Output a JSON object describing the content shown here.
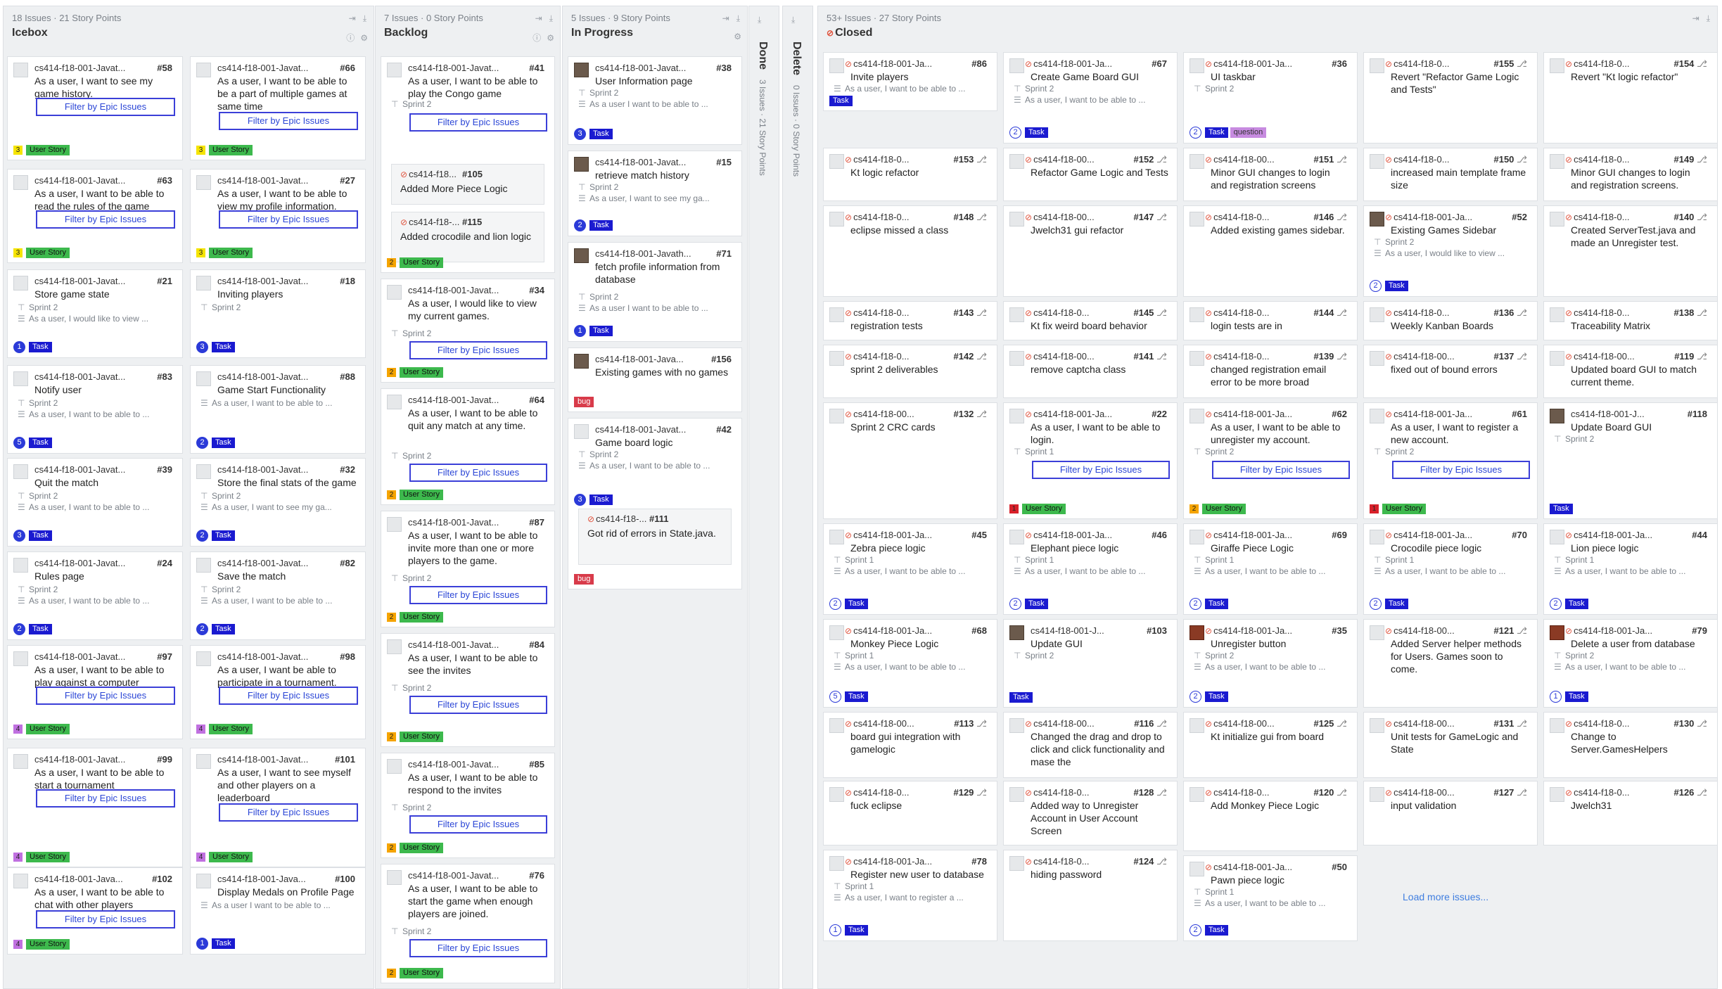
{
  "columns": {
    "icebox": {
      "count": "18 Issues · 21 Story Points",
      "title": "Icebox"
    },
    "backlog": {
      "count": "7 Issues · 0 Story Points",
      "title": "Backlog"
    },
    "inprogress": {
      "count": "5 Issues · 9 Story Points",
      "title": "In Progress"
    },
    "done": {
      "title": "Done",
      "count": "3 Issues · 21 Story Points"
    },
    "delete": {
      "title": "Delete",
      "count": "0 Issues · 0 Story Points"
    },
    "closed": {
      "count": "53+ Issues · 27 Story Points",
      "title": "Closed"
    }
  },
  "filter_label": "Filter by Epic Issues",
  "labels": {
    "task": "Task",
    "user_story": "User Story",
    "bug": "bug",
    "question": "question"
  },
  "load_more": "Load more issues...",
  "colors": {
    "task": "#1a1ad0",
    "user_story": "#3db94d",
    "bug": "#d83b4a",
    "question": "#c78be0",
    "link": "#2b46d6"
  },
  "icons": {
    "pin": "pin-icon",
    "sprint": "sprint-milestone-icon",
    "body": "description-icon",
    "closed": "closed-issue-icon",
    "pr": "pull-request-icon"
  },
  "icebox": [
    {
      "ref": "cs414-f18-001-Javat...",
      "num": "#58",
      "title": "As a user, I want to see my game history.",
      "pts": "3"
    },
    {
      "ref": "cs414-f18-001-Javat...",
      "num": "#66",
      "title": "As a user, I want to be able to be a part of multiple games at same time",
      "pts": "3"
    },
    {
      "ref": "cs414-f18-001-Javat...",
      "num": "#63",
      "title": "As a user, I want to be able to read the rules of the game",
      "pts": "3"
    },
    {
      "ref": "cs414-f18-001-Javat...",
      "num": "#27",
      "title": "As a user, I want to be able to view my profile information.",
      "pts": "3"
    },
    {
      "ref": "cs414-f18-001-Javat...",
      "num": "#21",
      "title": "Store game state",
      "sprint": "Sprint 2",
      "body": "As a user, I would like to view ...",
      "pts": "1"
    },
    {
      "ref": "cs414-f18-001-Javat...",
      "num": "#18",
      "title": "Inviting players",
      "sprint": "Sprint 2",
      "pts": "3"
    },
    {
      "ref": "cs414-f18-001-Javat...",
      "num": "#83",
      "title": "Notify user",
      "sprint": "Sprint 2",
      "body": "As a user, I want to be able to ...",
      "pts": "5"
    },
    {
      "ref": "cs414-f18-001-Javat...",
      "num": "#88",
      "title": "Game Start Functionality",
      "body": "As a user, I want to be able to ...",
      "pts": "2"
    },
    {
      "ref": "cs414-f18-001-Javat...",
      "num": "#39",
      "title": "Quit the match",
      "sprint": "Sprint 2",
      "body": "As a user, I want to be able to ...",
      "pts": "3"
    },
    {
      "ref": "cs414-f18-001-Javat...",
      "num": "#32",
      "title": "Store the final stats of the game",
      "sprint": "Sprint 2",
      "body": "As a user, I want to see my ga...",
      "pts": "2"
    },
    {
      "ref": "cs414-f18-001-Javat...",
      "num": "#24",
      "title": "Rules page",
      "sprint": "Sprint 2",
      "body": "As a user, I want to be able to ...",
      "pts": "2"
    },
    {
      "ref": "cs414-f18-001-Javat...",
      "num": "#82",
      "title": "Save the match",
      "sprint": "Sprint 2",
      "body": "As a user, I want to be able to ...",
      "pts": "2"
    },
    {
      "ref": "cs414-f18-001-Javat...",
      "num": "#97",
      "title": "As a user, I want to be able to play against a computer",
      "pts": "4"
    },
    {
      "ref": "cs414-f18-001-Javat...",
      "num": "#98",
      "title": "As a user, I want be able to participate in a tournament.",
      "pts": "4"
    },
    {
      "ref": "cs414-f18-001-Javat...",
      "num": "#99",
      "title": "As a user, I want to be able to start a tournament",
      "pts": "4"
    },
    {
      "ref": "cs414-f18-001-Javat...",
      "num": "#101",
      "title": "As a user, I want to see myself and other players on a leaderboard",
      "pts": "4"
    },
    {
      "ref": "cs414-f18-001-Java...",
      "num": "#102",
      "title": "As a user, I want to be able to chat with other players",
      "pts": "4"
    },
    {
      "ref": "cs414-f18-001-Java...",
      "num": "#100",
      "title": "Display Medals on Profile Page",
      "body": "As a user I want to be able to ...",
      "pts": "1"
    }
  ],
  "backlog": [
    {
      "ref": "cs414-f18-001-Javat...",
      "num": "#41",
      "title": "As a user, I want to be able to play the Congo game",
      "sprint": "Sprint 2",
      "pts": "2",
      "subs": [
        {
          "ref": "cs414-f18...",
          "num": "#105",
          "title": "Added More Piece Logic"
        },
        {
          "ref": "cs414-f18-...",
          "num": "#115",
          "title": "Added crocodile and lion logic"
        }
      ]
    },
    {
      "ref": "cs414-f18-001-Javat...",
      "num": "#34",
      "title": "As a user, I would like to view my current games.",
      "sprint": "Sprint 2",
      "pts": "2"
    },
    {
      "ref": "cs414-f18-001-Javat...",
      "num": "#64",
      "title": "As a user, I want to be able to quit any match at any time.",
      "sprint": "Sprint 2",
      "pts": "2"
    },
    {
      "ref": "cs414-f18-001-Javat...",
      "num": "#87",
      "title": "As a user, I want to be able to invite more than one or more players to the game.",
      "sprint": "Sprint 2",
      "pts": "2"
    },
    {
      "ref": "cs414-f18-001-Javat...",
      "num": "#84",
      "title": "As a user, I want to be able to see the invites",
      "sprint": "Sprint 2",
      "pts": "2"
    },
    {
      "ref": "cs414-f18-001-Javat...",
      "num": "#85",
      "title": "As a user, I want to be able to respond to the invites",
      "sprint": "Sprint 2",
      "pts": "2"
    },
    {
      "ref": "cs414-f18-001-Javat...",
      "num": "#76",
      "title": "As a user, I want to be able to start the game when enough players are joined.",
      "sprint": "Sprint 2",
      "pts": "2"
    }
  ],
  "inprogress": [
    {
      "ref": "cs414-f18-001-Javat...",
      "num": "#38",
      "title": "User Information page",
      "sprint": "Sprint 2",
      "body": "As a user I want to be able to ...",
      "pts": "3"
    },
    {
      "ref": "cs414-f18-001-Javat...",
      "num": "#15",
      "title": "retrieve match history",
      "sprint": "Sprint 2",
      "body": "As a user, I want to see my ga...",
      "pts": "2"
    },
    {
      "ref": "cs414-f18-001-Javath...",
      "num": "#71",
      "title": "fetch profile information from database",
      "sprint": "Sprint 2",
      "body": "As a user I want to be able to ...",
      "pts": "1"
    },
    {
      "ref": "cs414-f18-001-Java...",
      "num": "#156",
      "title": "Existing games with no games"
    },
    {
      "ref": "cs414-f18-001-Javat...",
      "num": "#42",
      "title": "Game board logic",
      "sprint": "Sprint 2",
      "body": "As a user, I want to be able to ...",
      "pts": "3",
      "subs": [
        {
          "ref": "cs414-f18-...",
          "num": "#111",
          "title": "Got rid of errors in State.java."
        }
      ]
    }
  ],
  "closed": [
    [
      {
        "ref": "cs414-f18-001-Ja...",
        "num": "#86",
        "title": "Invite players",
        "body": "As a user, I want to be able to ..."
      },
      {
        "ref": "cs414-f18-0...",
        "num": "#153",
        "title": "Kt logic refactor"
      },
      {
        "ref": "cs414-f18-0...",
        "num": "#148",
        "title": "eclipse missed a class"
      },
      {
        "ref": "cs414-f18-0...",
        "num": "#143",
        "title": "registration tests"
      },
      {
        "ref": "cs414-f18-0...",
        "num": "#142",
        "title": "sprint 2 deliverables"
      },
      {
        "ref": "cs414-f18-00...",
        "num": "#132",
        "title": "Sprint 2 CRC cards"
      },
      {
        "ref": "cs414-f18-001-Ja...",
        "num": "#45",
        "title": "Zebra piece logic",
        "sprint": "Sprint 1",
        "body": "As a user, I want to be able to ...",
        "pts": "2"
      },
      {
        "ref": "cs414-f18-001-Ja...",
        "num": "#68",
        "title": "Monkey Piece Logic",
        "sprint": "Sprint 1",
        "body": "As a user, I want to be able to ...",
        "pts": "5"
      },
      {
        "ref": "cs414-f18-00...",
        "num": "#113",
        "title": "board gui integration with gamelogic"
      },
      {
        "ref": "cs414-f18-0...",
        "num": "#129",
        "title": "fuck eclipse"
      },
      {
        "ref": "cs414-f18-001-Ja...",
        "num": "#78",
        "title": "Register new user to database",
        "sprint": "Sprint 1",
        "body": "As a user, I want to register a ...",
        "pts": "1"
      }
    ],
    [
      {
        "ref": "cs414-f18-001-Ja...",
        "num": "#67",
        "title": "Create Game Board GUI",
        "sprint": "Sprint 2",
        "body": "As a user, I want to be able to ...",
        "pts": "2"
      },
      {
        "ref": "cs414-f18-00...",
        "num": "#152",
        "title": "Refactor Game Logic and Tests"
      },
      {
        "ref": "cs414-f18-00...",
        "num": "#147",
        "title": "Jwelch31 gui refactor"
      },
      {
        "ref": "cs414-f18-0...",
        "num": "#145",
        "title": "Kt fix weird board behavior"
      },
      {
        "ref": "cs414-f18-00...",
        "num": "#141",
        "title": "remove captcha class"
      },
      {
        "ref": "cs414-f18-001-Ja...",
        "num": "#22",
        "title": "As a user, I want to be able to login.",
        "sprint": "Sprint 1",
        "pts": "1"
      },
      {
        "ref": "cs414-f18-001-Ja...",
        "num": "#46",
        "title": "Elephant piece logic",
        "sprint": "Sprint 1",
        "body": "As a user, I want to be able to ...",
        "pts": "2"
      },
      {
        "ref": "cs414-f18-001-J...",
        "num": "#103",
        "title": "Update GUI",
        "sprint": "Sprint 2"
      },
      {
        "ref": "cs414-f18-00...",
        "num": "#116",
        "title": "Changed the drag and drop to click and click functionality and mase the"
      },
      {
        "ref": "cs414-f18-0...",
        "num": "#128",
        "title": "Added way to Unregister Account in User Account Screen"
      },
      {
        "ref": "cs414-f18-0...",
        "num": "#124",
        "title": "hiding password"
      }
    ],
    [
      {
        "ref": "cs414-f18-001-Ja...",
        "num": "#36",
        "title": "UI taskbar",
        "sprint": "Sprint 2",
        "pts": "2"
      },
      {
        "ref": "cs414-f18-00...",
        "num": "#151",
        "title": "Minor GUI changes to login and registration screens"
      },
      {
        "ref": "cs414-f18-0...",
        "num": "#146",
        "title": "Added existing games sidebar."
      },
      {
        "ref": "cs414-f18-0...",
        "num": "#144",
        "title": "login tests are in"
      },
      {
        "ref": "cs414-f18-0...",
        "num": "#139",
        "title": "changed registration email error to be more broad"
      },
      {
        "ref": "cs414-f18-001-Ja...",
        "num": "#62",
        "title": "As a user, I want to be able to unregister my account.",
        "sprint": "Sprint 2",
        "pts": "2"
      },
      {
        "ref": "cs414-f18-001-Ja...",
        "num": "#69",
        "title": "Giraffe Piece Logic",
        "sprint": "Sprint 1",
        "body": "As a user, I want to be able to ...",
        "pts": "2"
      },
      {
        "ref": "cs414-f18-001-Ja...",
        "num": "#35",
        "title": "Unregister button",
        "sprint": "Sprint 2",
        "body": "As a user, I want to be able to ...",
        "pts": "2"
      },
      {
        "ref": "cs414-f18-00...",
        "num": "#125",
        "title": "Kt initialize gui from board"
      },
      {
        "ref": "cs414-f18-0...",
        "num": "#120",
        "title": "Add Monkey Piece Logic"
      },
      {
        "ref": "cs414-f18-001-Ja...",
        "num": "#50",
        "title": "Pawn piece logic",
        "sprint": "Sprint 1",
        "body": "As a user, I want to be able to ...",
        "pts": "2"
      }
    ],
    [
      {
        "ref": "cs414-f18-0...",
        "num": "#155",
        "title": "Revert \"Refactor Game Logic and Tests\""
      },
      {
        "ref": "cs414-f18-0...",
        "num": "#150",
        "title": "increased main template frame size"
      },
      {
        "ref": "cs414-f18-001-Ja...",
        "num": "#52",
        "title": "Existing Games Sidebar",
        "sprint": "Sprint 2",
        "body": "As a user, I would like to view ...",
        "pts": "2"
      },
      {
        "ref": "cs414-f18-0...",
        "num": "#136",
        "title": "Weekly Kanban Boards"
      },
      {
        "ref": "cs414-f18-00...",
        "num": "#137",
        "title": "fixed out of bound errors"
      },
      {
        "ref": "cs414-f18-001-Ja...",
        "num": "#61",
        "title": "As a user, I want to register a new account.",
        "sprint": "Sprint 2",
        "pts": "1"
      },
      {
        "ref": "cs414-f18-001-Ja...",
        "num": "#70",
        "title": "Crocodile piece logic",
        "sprint": "Sprint 1",
        "body": "As a user, I want to be able to ...",
        "pts": "2"
      },
      {
        "ref": "cs414-f18-00...",
        "num": "#121",
        "title": "Added Server helper methods for Users. Games soon to come."
      },
      {
        "ref": "cs414-f18-00...",
        "num": "#131",
        "title": "Unit tests for GameLogic and State"
      },
      {
        "ref": "cs414-f18-00...",
        "num": "#127",
        "title": "input validation"
      }
    ],
    [
      {
        "ref": "cs414-f18-0...",
        "num": "#154",
        "title": "Revert \"Kt logic refactor\""
      },
      {
        "ref": "cs414-f18-0...",
        "num": "#149",
        "title": "Minor GUI changes to login and registration screens."
      },
      {
        "ref": "cs414-f18-0...",
        "num": "#140",
        "title": "Created ServerTest.java and made an Unregister test."
      },
      {
        "ref": "cs414-f18-0...",
        "num": "#138",
        "title": "Traceability Matrix"
      },
      {
        "ref": "cs414-f18-00...",
        "num": "#119",
        "title": "Updated board GUI to match current theme."
      },
      {
        "ref": "cs414-f18-001-J...",
        "num": "#118",
        "title": "Update Board GUI",
        "sprint": "Sprint 2"
      },
      {
        "ref": "cs414-f18-001-Ja...",
        "num": "#44",
        "title": "Lion piece logic",
        "sprint": "Sprint 1",
        "body": "As a user, I want to be able to ...",
        "pts": "2"
      },
      {
        "ref": "cs414-f18-001-Ja...",
        "num": "#79",
        "title": "Delete a user from database",
        "sprint": "Sprint 2",
        "body": "As a user, I want to be able to ...",
        "pts": "1"
      },
      {
        "ref": "cs414-f18-0...",
        "num": "#130",
        "title": "Change to Server.GamesHelpers"
      },
      {
        "ref": "cs414-f18-0...",
        "num": "#126",
        "title": "Jwelch31"
      }
    ]
  ]
}
